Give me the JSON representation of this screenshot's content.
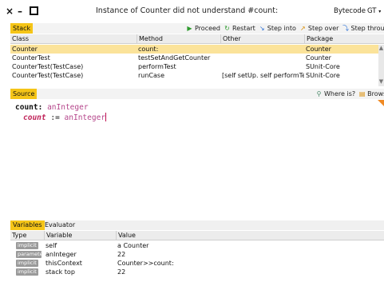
{
  "window": {
    "title": "Instance of Counter did not understand #count:",
    "close_glyph": "×",
    "minimize_glyph": "–",
    "bytecode_label": "Bytecode",
    "gt_label": "GT",
    "gt_arrow": "▾"
  },
  "stack": {
    "tab_label": "Stack",
    "toolbar": {
      "proceed": "Proceed",
      "restart": "Restart",
      "step_into": "Step into",
      "step_over": "Step over",
      "step_through": "Step through"
    },
    "columns": [
      "Class",
      "Method",
      "Other",
      "Package"
    ],
    "rows": [
      {
        "class": "Counter",
        "method": "count:",
        "other": "",
        "package": "Counter",
        "selected": true
      },
      {
        "class": "CounterTest",
        "method": "testSetAndGetCounter",
        "other": "",
        "package": "Counter",
        "selected": false
      },
      {
        "class": "CounterTest(TestCase)",
        "method": "performTest",
        "other": "",
        "package": "SUnit-Core",
        "selected": false
      },
      {
        "class": "CounterTest(TestCase)",
        "method": "runCase",
        "other": "[self setUp. self performTest",
        "package": "SUnit-Core",
        "selected": false
      }
    ]
  },
  "source": {
    "tab_label": "Source",
    "where_is": "Where is?",
    "browse": "Browse",
    "line1_selector": "count:",
    "line1_arg": "anInteger",
    "line2_var": "count",
    "line2_assign": ":=",
    "line2_arg": "anInteger"
  },
  "variables": {
    "tab_variables": "Variables",
    "tab_evaluator": "Evaluator",
    "columns": [
      "Type",
      "Variable",
      "Value"
    ],
    "rows": [
      {
        "type": "implicit",
        "variable": "self",
        "value": "a Counter"
      },
      {
        "type": "parameter",
        "variable": "anInteger",
        "value": "22"
      },
      {
        "type": "implicit",
        "variable": "thisContext",
        "value": "Counter>>count:"
      },
      {
        "type": "implicit",
        "variable": "stack top",
        "value": "22"
      }
    ]
  },
  "colors": {
    "tab_accent": "#f5c518",
    "selected_row": "#fbe39a",
    "badge": "#9a9a9a"
  }
}
